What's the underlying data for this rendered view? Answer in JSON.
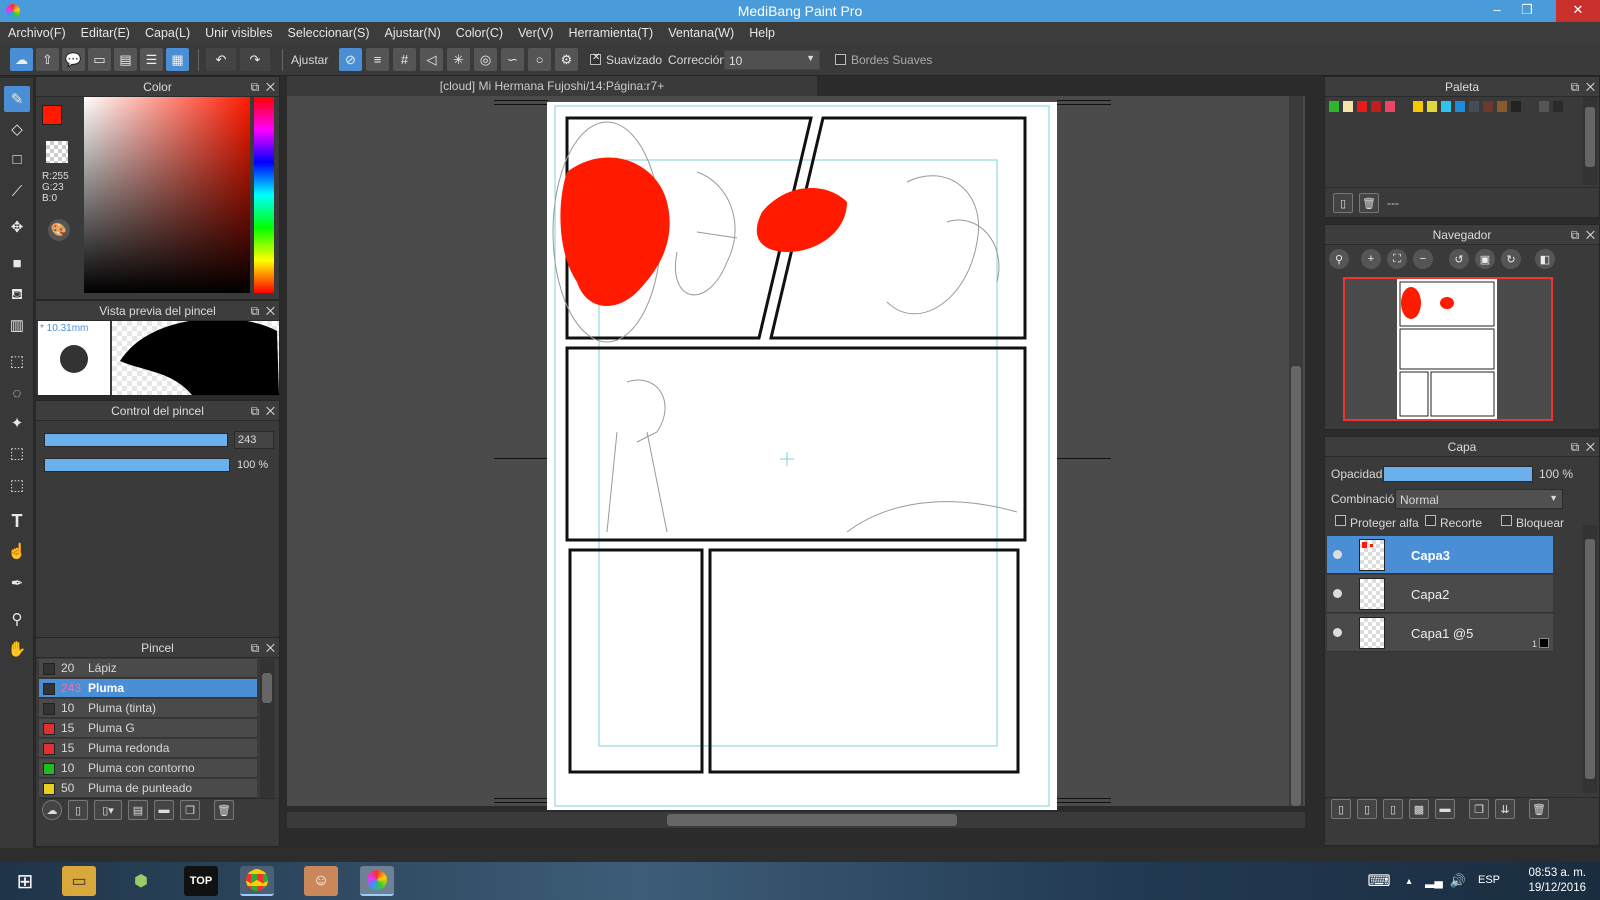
{
  "window": {
    "title": "MediBang Paint Pro",
    "min": "–",
    "max": "❐",
    "close": "✕"
  },
  "menu": [
    "Archivo(F)",
    "Editar(E)",
    "Capa(L)",
    "Unir visibles",
    "Seleccionar(S)",
    "Ajustar(N)",
    "Color(C)",
    "Ver(V)",
    "Herramienta(T)",
    "Ventana(W)",
    "Help"
  ],
  "toolbar": {
    "ajustar_label": "Ajustar",
    "suavizado_label": "Suavizado",
    "correccion_label": "Corrección",
    "correccion_value": "10",
    "bordes_label": "Bordes Suaves"
  },
  "color_panel": {
    "title": "Color",
    "primary_color": "#ff1a00",
    "r": "R:255",
    "g": "G:23",
    "b": "B:0"
  },
  "brush_preview": {
    "title": "Vista previa del pincel",
    "size": "* 10.31mm"
  },
  "brush_control": {
    "title": "Control del pincel",
    "size_value": "243",
    "opacity_value": "100 %"
  },
  "brush_list": {
    "title": "Pincel",
    "items": [
      {
        "size": "20",
        "name": "Lápiz",
        "color": "#333333"
      },
      {
        "size": "243",
        "name": "Pluma",
        "color": "#333333"
      },
      {
        "size": "10",
        "name": "Pluma (tinta)",
        "color": "#333333"
      },
      {
        "size": "15",
        "name": "Pluma G",
        "color": "#e03030"
      },
      {
        "size": "15",
        "name": "Pluma redonda",
        "color": "#e03030"
      },
      {
        "size": "10",
        "name": "Pluma con contorno",
        "color": "#22bb22"
      },
      {
        "size": "50",
        "name": "Pluma de punteado",
        "color": "#e8d020"
      }
    ]
  },
  "document": {
    "tab_title": "[cloud] Mi Hermana Fujoshi/14:Página:r7+"
  },
  "palette_panel": {
    "title": "Paleta",
    "colors": [
      "#2db52d",
      "#f7e2a8",
      "#e81a1a",
      "#c01e1e",
      "#ee4466",
      "#3a3a3a",
      "#f5c800",
      "#e3d63a",
      "#2ec4ee",
      "#1e8bd8",
      "#444c55",
      "#6b3a2a",
      "#8a5a2a",
      "#222222",
      "#3a3a3a",
      "#555555",
      "#2a2a2a"
    ],
    "name": "---"
  },
  "navigator_panel": {
    "title": "Navegador"
  },
  "layer_panel": {
    "title": "Capa",
    "opacity_label": "Opacidad",
    "opacity_value": "100 %",
    "blend_label": "Combinación",
    "blend_value": "Normal",
    "protect_alpha": "Proteger alfa",
    "clip": "Recorte",
    "lock": "Bloquear",
    "layers": [
      {
        "name": "Capa3",
        "selected": true
      },
      {
        "name": "Capa2",
        "selected": false
      },
      {
        "name": "Capa1 @5",
        "selected": false,
        "badge": "1"
      }
    ]
  },
  "taskbar": {
    "lang": "ESP",
    "time": "08:53 a. m.",
    "date": "19/12/2016",
    "top_app_label": "TOP"
  },
  "accent_color": "#4a8fd6"
}
